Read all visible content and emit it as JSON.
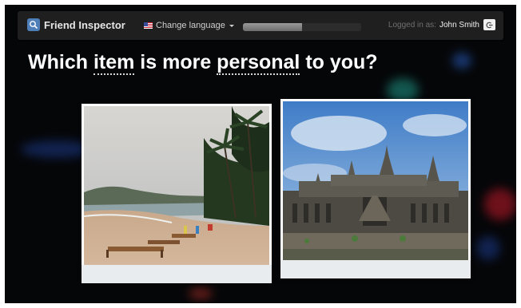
{
  "header": {
    "app_title": "Friend Inspector",
    "language_label": "Change language",
    "progress": 0.5,
    "logged_in_prefix": "Logged in as:",
    "user_name": "John Smith"
  },
  "question": {
    "parts": [
      "Which ",
      "item",
      " is more ",
      "personal",
      " to you?"
    ]
  },
  "options": [
    {
      "name": "option-beach-photo",
      "subject": "tropical beach with palm trees"
    },
    {
      "name": "option-temple-photo",
      "subject": "ancient stone temple"
    }
  ],
  "colors": {
    "background": "#050608",
    "navbar": "#1f1f1f",
    "accent": "#4f7fb8",
    "card_strip": "#e8ecef"
  },
  "icons": [
    "friend-inspector-logo-icon",
    "us-flag-icon",
    "caret-down-icon",
    "logout-icon"
  ]
}
